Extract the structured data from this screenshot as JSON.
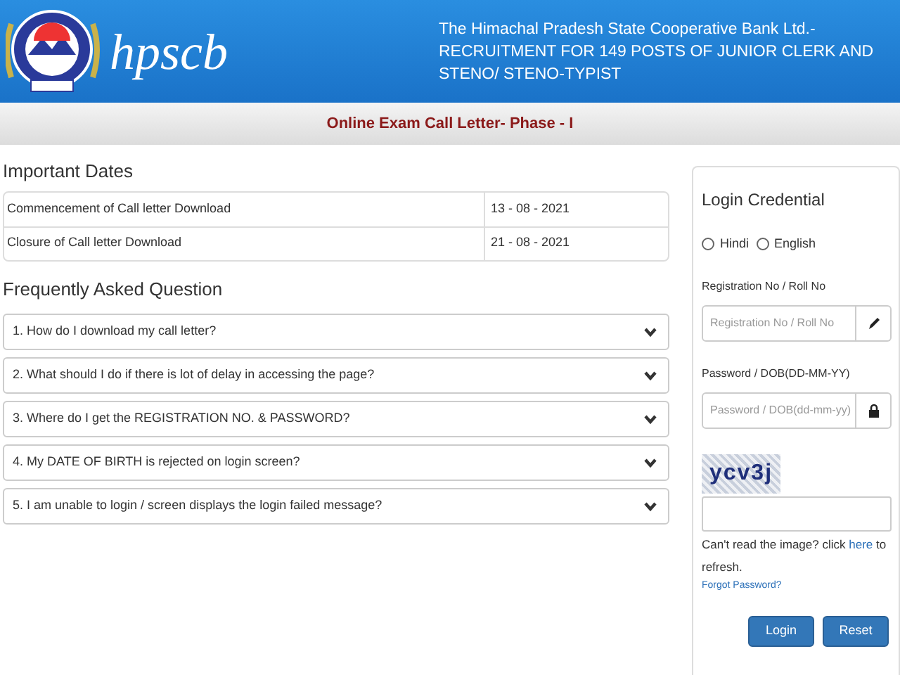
{
  "header": {
    "logo_text": "hpscb",
    "title_lines": [
      "The Himachal Pradesh State Cooperative Bank Ltd.-",
      "RECRUITMENT FOR 149 POSTS OF JUNIOR CLERK AND",
      "STENO/ STENO-TYPIST"
    ]
  },
  "subheader": "Online Exam Call Letter- Phase - I",
  "important_dates": {
    "heading": "Important Dates",
    "rows": [
      {
        "event": "Commencement of Call letter Download",
        "date": "13 - 08 - 2021"
      },
      {
        "event": "Closure of Call letter Download",
        "date": "21 - 08 - 2021"
      }
    ]
  },
  "faq": {
    "heading": "Frequently Asked Question",
    "items": [
      {
        "question": "1. How do I download my call letter?",
        "expanded": false
      },
      {
        "question": "2. What should I do if there is lot of delay in accessing the page?",
        "expanded": false
      },
      {
        "question": "3. Where do I get the REGISTRATION NO. & PASSWORD?",
        "expanded": false
      },
      {
        "question": "4. My DATE OF BIRTH is rejected on login screen?",
        "expanded": false
      },
      {
        "question": "5. I am unable to login / screen displays the login failed message?",
        "expanded": false
      }
    ]
  },
  "login": {
    "heading": "Login Credential",
    "languages": [
      {
        "label": "Hindi",
        "selected": false
      },
      {
        "label": "English",
        "selected": false
      }
    ],
    "registration": {
      "label": "Registration No / Roll No",
      "placeholder": "Registration No / Roll No"
    },
    "password": {
      "label": "Password / DOB(DD-MM-YY)",
      "placeholder": "Password / DOB(dd-mm-yy)"
    },
    "captcha": "ycv3j",
    "refresh_text": {
      "before": "Can't read the image? click ",
      "link": "here",
      "after": " to refresh."
    },
    "forgot": "Forgot Password?",
    "buttons": [
      "Login",
      "Reset"
    ]
  }
}
